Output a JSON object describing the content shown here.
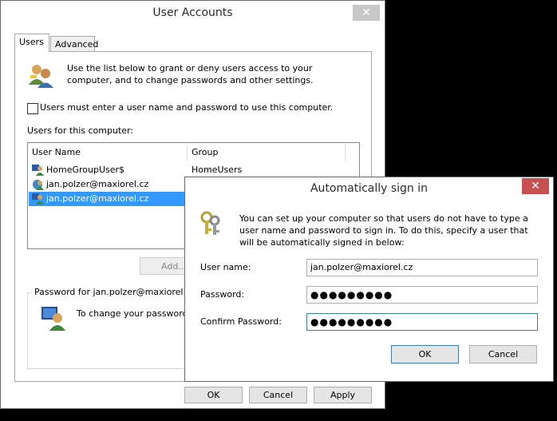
{
  "main_window": {
    "title": "User Accounts",
    "close_glyph": "✕",
    "tabs": [
      {
        "label": "Users"
      },
      {
        "label": "Advanced"
      }
    ],
    "intro_text": "Use the list below to grant or deny users access to your computer, and to change passwords and other settings.",
    "must_enter_label": "Users must enter a user name and password to use this computer.",
    "must_enter_checked": false,
    "users_heading": "Users for this computer:",
    "columns": {
      "username": "User Name",
      "group": "Group"
    },
    "rows": [
      {
        "name": "HomeGroupUser$",
        "group": "HomeUsers"
      },
      {
        "name": "jan.polzer@maxiorel.cz",
        "group": ""
      },
      {
        "name": "jan.polzer@maxiorel.cz",
        "group": "",
        "selected": true
      }
    ],
    "add_button": "Add...",
    "password_group_title": "Password for jan.polzer@maxiorel.cz",
    "password_change_text": "To change your password",
    "buttons": {
      "ok": "OK",
      "cancel": "Cancel",
      "apply": "Apply"
    }
  },
  "dialog": {
    "title": "Automatically sign in",
    "close_glyph": "✕",
    "description": "You can set up your computer so that users do not have to type a user name and password to sign in. To do this, specify a user that will be automatically signed in below:",
    "fields": {
      "username_label": "User name:",
      "username_value": "jan.polzer@maxiorel.cz",
      "password_label": "Password:",
      "password_value": "●●●●●●●●●",
      "confirm_label": "Confirm Password:",
      "confirm_value": "●●●●●●●●●"
    },
    "buttons": {
      "ok": "OK",
      "cancel": "Cancel"
    }
  },
  "colors": {
    "selection": "#3399ff",
    "close_active": "#c75050",
    "accent_border": "#3c7fb1"
  }
}
